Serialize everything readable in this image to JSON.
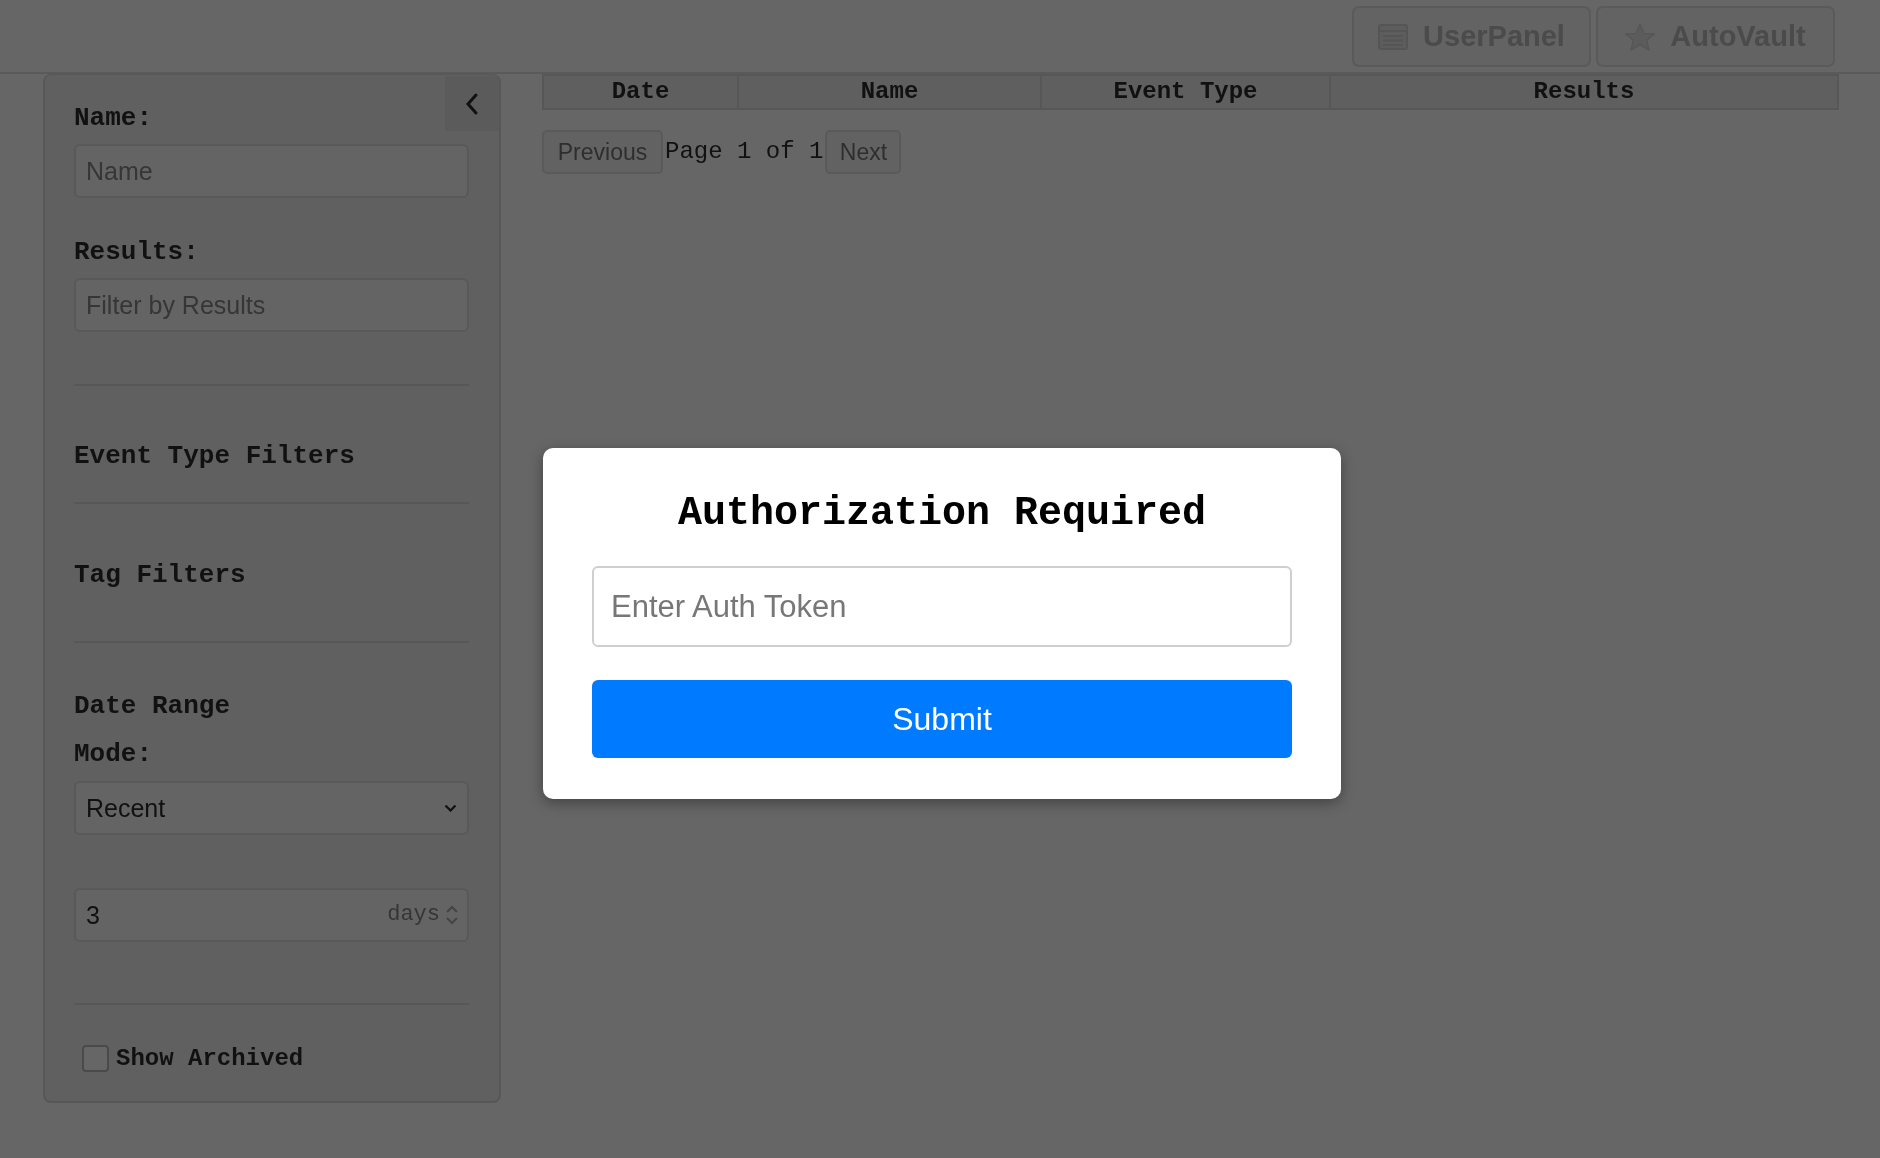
{
  "header": {
    "buttons": [
      {
        "label": "UserPanel"
      },
      {
        "label": "AutoVault"
      }
    ]
  },
  "sidebar": {
    "fields": [
      {
        "label": "Name:",
        "placeholder": "Name"
      },
      {
        "label": "Results:",
        "placeholder": "Filter by Results"
      }
    ],
    "sections": [
      {
        "title": "Event Type Filters"
      },
      {
        "title": "Tag Filters"
      }
    ],
    "date_range": {
      "title": "Date Range",
      "mode_label": "Mode:",
      "mode_value": "Recent",
      "days_value": "3",
      "days_unit": "days"
    },
    "show_archived": {
      "label": "Show Archived",
      "checked": false
    }
  },
  "table": {
    "columns": [
      "Date",
      "Name",
      "Event Type",
      "Results"
    ]
  },
  "pagination": {
    "previous": {
      "label": "Previous",
      "disabled": true
    },
    "page_info": "Page 1 of 1",
    "next": {
      "label": "Next",
      "disabled": true
    }
  },
  "modal": {
    "title": "Authorization Required",
    "token_placeholder": "Enter Auth Token",
    "submit": "Submit"
  }
}
